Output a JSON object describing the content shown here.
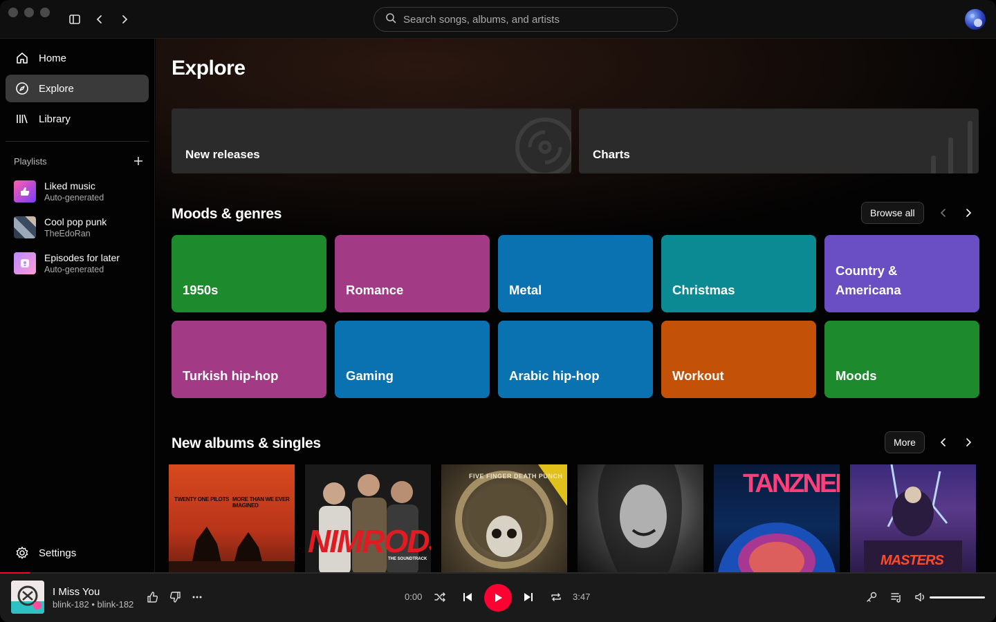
{
  "search": {
    "placeholder": "Search songs, albums, and artists"
  },
  "nav": [
    {
      "label": "Home",
      "icon": "home-icon"
    },
    {
      "label": "Explore",
      "icon": "compass-icon",
      "active": true
    },
    {
      "label": "Library",
      "icon": "library-icon"
    }
  ],
  "playlists": {
    "title": "Playlists",
    "items": [
      {
        "name": "Liked music",
        "sub": "Auto-generated"
      },
      {
        "name": "Cool pop punk",
        "sub": "TheEdoRan"
      },
      {
        "name": "Episodes for later",
        "sub": "Auto-generated"
      }
    ]
  },
  "settings_label": "Settings",
  "main": {
    "title": "Explore",
    "cards": [
      "New releases",
      "Charts"
    ],
    "moods": {
      "title": "Moods & genres",
      "browse_label": "Browse all",
      "items": [
        {
          "label": "1950s",
          "color": "#1e8a2e"
        },
        {
          "label": "Romance",
          "color": "#a23a86"
        },
        {
          "label": "Metal",
          "color": "#0a72b0"
        },
        {
          "label": "Christmas",
          "color": "#0b8a93"
        },
        {
          "label": "Country & Americana",
          "color": "#6a4fc4"
        },
        {
          "label": "Turkish hip-hop",
          "color": "#a23a86"
        },
        {
          "label": "Gaming",
          "color": "#0a72b0"
        },
        {
          "label": "Arabic hip-hop",
          "color": "#0a72b0"
        },
        {
          "label": "Workout",
          "color": "#c35208"
        },
        {
          "label": "Moods",
          "color": "#1e8a2e"
        }
      ]
    },
    "albums": {
      "title": "New albums & singles",
      "more_label": "More",
      "art_text": [
        "TWENTY ONE PILOTS",
        "MORE THAN WE EVER IMAGINED",
        "NIMRODS",
        "THE SOUNDTRACK",
        "FIVE FINGER DEATH PUNCH",
        "TANZNEID",
        "MASTERS"
      ]
    }
  },
  "player": {
    "title": "I Miss You",
    "artist": "blink-182 • blink-182",
    "elapsed": "0:00",
    "duration": "3:47",
    "progress": 0.03,
    "volume": 1.0
  },
  "colors": {
    "accent": "#ff0033"
  }
}
